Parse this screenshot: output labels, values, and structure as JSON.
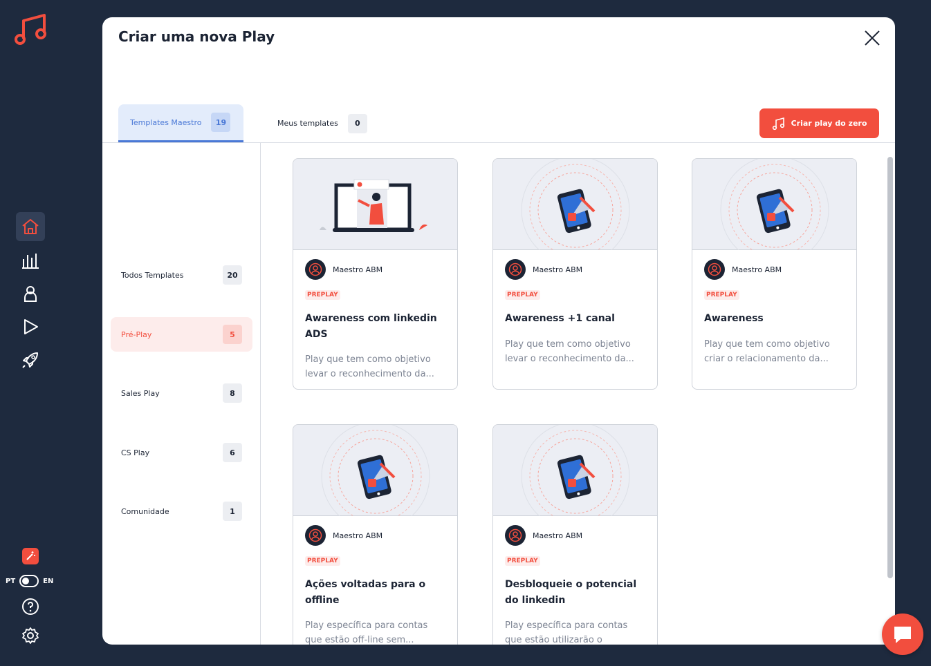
{
  "modal": {
    "title": "Criar uma nova Play",
    "tabs": [
      {
        "label": "Templates Maestro",
        "count": "19"
      },
      {
        "label": "Meus templates",
        "count": "0"
      }
    ],
    "new_button": "Criar play do zero"
  },
  "filters": [
    {
      "label": "Todos Templates",
      "count": "20"
    },
    {
      "label": "Pré-Play",
      "count": "5"
    },
    {
      "label": "Sales Play",
      "count": "8"
    },
    {
      "label": "CS Play",
      "count": "6"
    },
    {
      "label": "Comunidade",
      "count": "1"
    }
  ],
  "cards": [
    {
      "author": "Maestro ABM",
      "badge": "PREPLAY",
      "title": "Awareness com linkedin ADS",
      "desc": "Play que tem como objetivo levar o reconhecimento da..."
    },
    {
      "author": "Maestro ABM",
      "badge": "PREPLAY",
      "title": "Awareness +1 canal",
      "desc": "Play que tem como objetivo levar o reconhecimento da..."
    },
    {
      "author": "Maestro ABM",
      "badge": "PREPLAY",
      "title": "Awareness",
      "desc": "Play que tem como objetivo criar o relacionamento da..."
    },
    {
      "author": "Maestro ABM",
      "badge": "PREPLAY",
      "title": "Ações voltadas para o offline",
      "desc": "Play específica para contas que estão off-line sem..."
    },
    {
      "author": "Maestro ABM",
      "badge": "PREPLAY",
      "title": "Desbloqueie o potencial do linkedin",
      "desc": "Play específica para contas que estão utilizarão o linkedin..."
    }
  ],
  "lang": {
    "left": "PT",
    "right": "EN"
  },
  "colors": {
    "accent": "#f24e3e",
    "blue": "#4a78d6",
    "rail": "#1e2a3e"
  }
}
